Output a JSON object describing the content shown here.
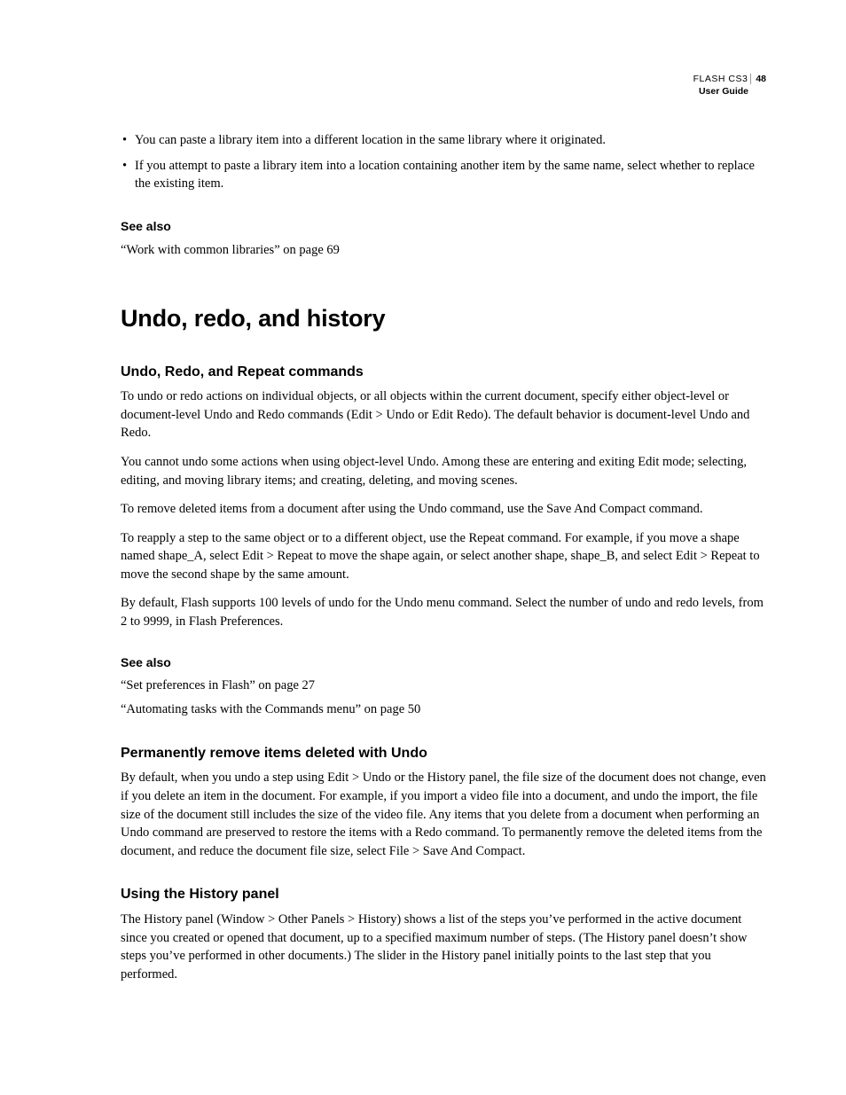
{
  "header": {
    "product": "FLASH CS3",
    "page_number": "48",
    "subtitle": "User Guide"
  },
  "intro_bullets": [
    "You can paste a library item into a different location in the same library where it originated.",
    "If you attempt to paste a library item into a location containing another item by the same name, select whether to replace the existing item."
  ],
  "see_also_1": {
    "heading": "See also",
    "link": "“Work with common libraries” on page 69"
  },
  "main_heading": "Undo, redo, and history",
  "section1": {
    "heading": "Undo, Redo, and Repeat commands",
    "p1": "To undo or redo actions on individual objects, or all objects within the current document, specify either object-level or document-level Undo and Redo commands (Edit > Undo or Edit Redo). The default behavior is document-level Undo and Redo.",
    "p2": "You cannot undo some actions when using object-level Undo. Among these are entering and exiting Edit mode; selecting, editing, and moving library items; and creating, deleting, and moving scenes.",
    "p3": "To remove deleted items from a document after using the Undo command, use the Save And Compact command.",
    "p4": "To reapply a step to the same object or to a different object, use the Repeat command. For example, if you move a shape named shape_A, select Edit > Repeat to move the shape again, or select another shape, shape_B, and select Edit > Repeat to move the second shape by the same amount.",
    "p5": "By default, Flash supports 100 levels of undo for the Undo menu command. Select the number of undo and redo levels, from 2 to 9999, in Flash Preferences."
  },
  "see_also_2": {
    "heading": "See also",
    "link1": "“Set preferences in Flash” on page 27",
    "link2": "“Automating tasks with the Commands menu” on page 50"
  },
  "section2": {
    "heading": "Permanently remove items deleted with Undo",
    "p1": "By default, when you undo a step using Edit > Undo or the History panel, the file size of the document does not change, even if you delete an item in the document. For example, if you import a video file into a document, and undo the import, the file size of the document still includes the size of the video file. Any items that you delete from a document when performing an Undo command are preserved to restore the items with a Redo command. To permanently remove the deleted items from the document, and reduce the document file size, select File > Save And Compact."
  },
  "section3": {
    "heading": "Using the History panel",
    "p1": "The History panel (Window > Other Panels > History) shows a list of the steps you’ve performed in the active document since you created or opened that document, up to a specified maximum number of steps. (The History panel doesn’t show steps you’ve performed in other documents.) The slider in the History panel initially points to the last step that you performed."
  }
}
